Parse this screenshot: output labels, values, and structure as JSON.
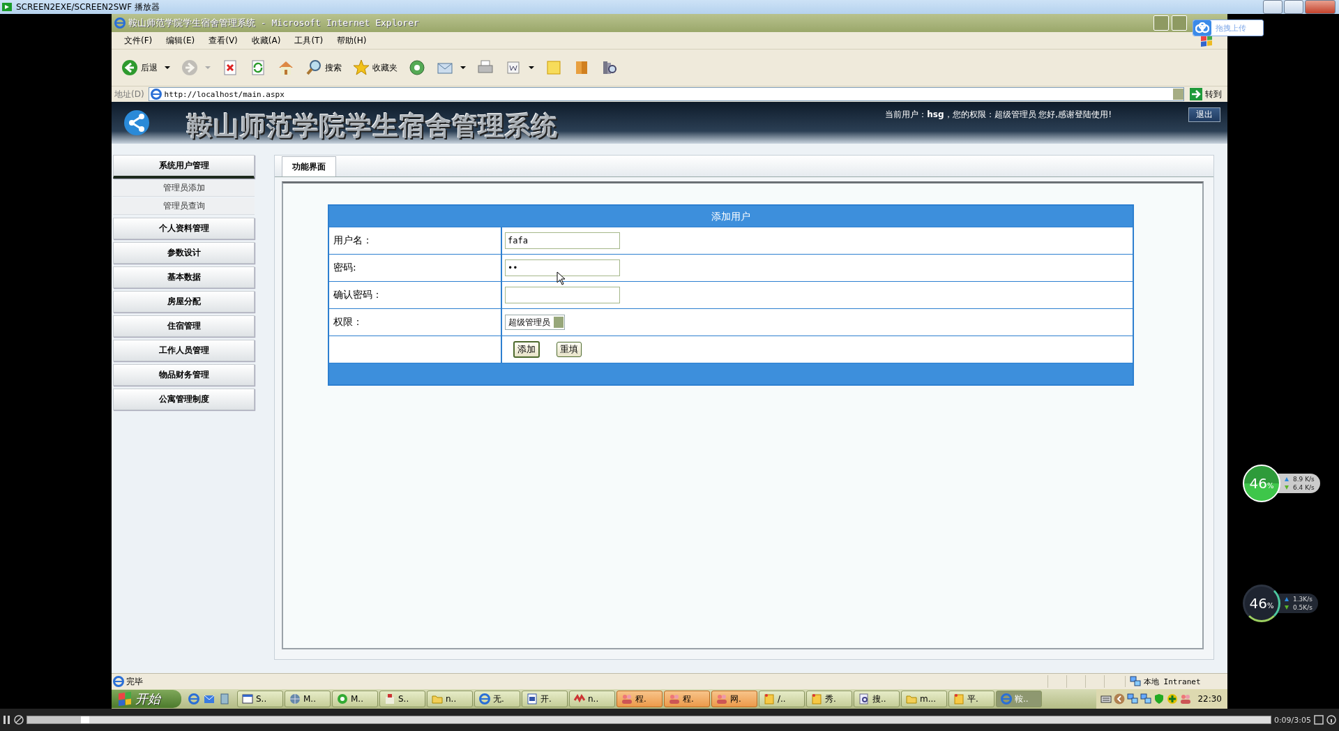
{
  "player": {
    "title": "SCREEN2EXE/SCREEN2SWF 播放器",
    "time": "0:09/3:05",
    "level": 0.05
  },
  "browser": {
    "title": "鞍山师范学院学生宿舍管理系统 - Microsoft Internet Explorer",
    "menu": [
      "文件(F)",
      "编辑(E)",
      "查看(V)",
      "收藏(A)",
      "工具(T)",
      "帮助(H)"
    ],
    "toolbar": [
      {
        "kind": "back",
        "label": "后退",
        "dropdown": true,
        "disabled": false
      },
      {
        "kind": "forward",
        "dropdown": true,
        "disabled": true
      },
      {
        "kind": "stop",
        "dropdown": false,
        "disabled": false
      },
      {
        "kind": "refresh",
        "dropdown": false,
        "disabled": false
      },
      {
        "kind": "home",
        "dropdown": false,
        "disabled": false
      },
      {
        "kind": "search",
        "label": "搜索",
        "dropdown": false,
        "disabled": false
      },
      {
        "kind": "favorites",
        "label": "收藏夹",
        "dropdown": false,
        "disabled": false
      },
      {
        "kind": "media",
        "dropdown": false,
        "disabled": false
      },
      {
        "kind": "mail",
        "dropdown": true,
        "disabled": false
      },
      {
        "kind": "print",
        "dropdown": false,
        "disabled": false
      },
      {
        "kind": "edit",
        "dropdown": true,
        "disabled": false
      },
      {
        "kind": "notes",
        "dropdown": false,
        "disabled": false
      },
      {
        "kind": "messenger",
        "dropdown": false,
        "disabled": false
      },
      {
        "kind": "research",
        "dropdown": false,
        "disabled": false
      }
    ],
    "address": {
      "label": "地址(D)",
      "value": "http://localhost/main.aspx",
      "go": "转到"
    },
    "status": {
      "text": "完毕",
      "zone": "本地 Intranet"
    }
  },
  "upload_popup": {
    "label": "拖拽上传"
  },
  "header": {
    "title": "鞍山师范学院学生宿舍管理系统",
    "user_info": "当前用户：**hsg**，您的权限：超级管理员  您好,感谢登陆使用!",
    "logout": "退出"
  },
  "sidebar": [
    {
      "label": "系统用户管理",
      "expanded": true,
      "children": [
        {
          "label": "管理员添加"
        },
        {
          "label": "管理员查询"
        }
      ]
    },
    {
      "label": "个人资料管理",
      "expanded": false
    },
    {
      "label": "参数设计",
      "expanded": false
    },
    {
      "label": "基本数据",
      "expanded": false
    },
    {
      "label": "房屋分配",
      "expanded": false
    },
    {
      "label": "住宿管理",
      "expanded": false
    },
    {
      "label": "工作人员管理",
      "expanded": false
    },
    {
      "label": "物品财务管理",
      "expanded": false
    },
    {
      "label": "公寓管理制度",
      "expanded": false
    }
  ],
  "tab": {
    "label": "功能界面",
    "selected": true
  },
  "form": {
    "title": "添加用户",
    "fields": [
      {
        "kind": "text",
        "label": "用户名：",
        "value": "fafa"
      },
      {
        "kind": "text",
        "label": "密码:",
        "value": "••"
      },
      {
        "kind": "text",
        "label": "确认密码："
      },
      {
        "kind": "select",
        "label": "权限：",
        "value": "超级管理员"
      }
    ],
    "buttons": [
      "添加",
      "重填"
    ]
  },
  "taskbar": {
    "start": "开始",
    "tasks": [
      {
        "kind": "window",
        "label": "S..",
        "flashing": false,
        "selected": false
      },
      {
        "kind": "globe",
        "label": "M..",
        "flashing": false,
        "selected": false
      },
      {
        "kind": "media",
        "label": "M..",
        "flashing": false,
        "selected": false
      },
      {
        "kind": "installer",
        "label": "S..",
        "flashing": false,
        "selected": false
      },
      {
        "kind": "folder",
        "label": "n..",
        "flashing": false,
        "selected": false
      },
      {
        "kind": "ie",
        "label": "无.",
        "flashing": false,
        "selected": false
      },
      {
        "kind": "word",
        "label": "开.",
        "flashing": false,
        "selected": false
      },
      {
        "kind": "app",
        "label": "n..",
        "flashing": false,
        "selected": false
      },
      {
        "kind": "users",
        "label": "程.",
        "flashing": true,
        "selected": false
      },
      {
        "kind": "users",
        "label": "程.",
        "flashing": true,
        "selected": false
      },
      {
        "kind": "users",
        "label": "网.",
        "flashing": true,
        "selected": false
      },
      {
        "kind": "note",
        "label": "/..",
        "flashing": false,
        "selected": false
      },
      {
        "kind": "note",
        "label": "秀.",
        "flashing": false,
        "selected": false
      },
      {
        "kind": "search",
        "label": "搜..",
        "flashing": false,
        "selected": false
      },
      {
        "kind": "folder",
        "label": "m...",
        "flashing": false,
        "selected": false
      },
      {
        "kind": "note",
        "label": "平.",
        "flashing": false,
        "selected": false
      },
      {
        "kind": "ie",
        "label": "鞍..",
        "flashing": false,
        "selected": true
      }
    ],
    "clock": "22:30"
  },
  "meters": [
    {
      "kind": "solid",
      "value": "46",
      "unit": "%",
      "up": "8.9 K/s",
      "down": "6.4 K/s"
    },
    {
      "kind": "ring",
      "value": "46",
      "unit": "%",
      "up": "1.3K/s",
      "down": "0.5K/s"
    }
  ]
}
